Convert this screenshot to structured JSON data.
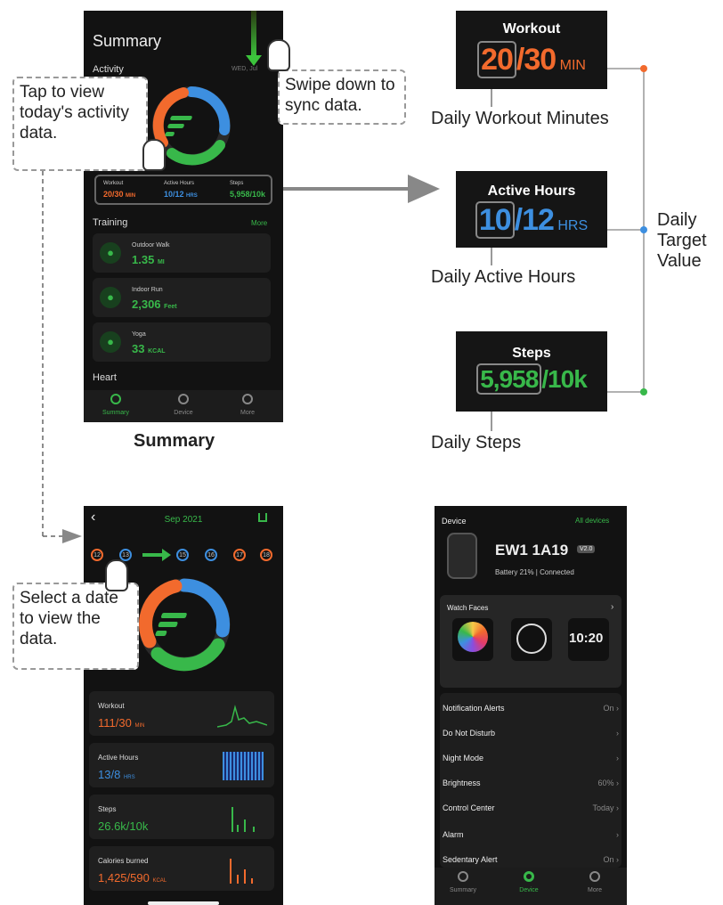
{
  "summary_screen": {
    "title": "Summary",
    "section_activity": "Activity",
    "date": "WED, Jul",
    "stats": [
      {
        "label": "Workout",
        "value": "20/30",
        "unit": "MIN"
      },
      {
        "label": "Active Hours",
        "value": "10/12",
        "unit": "HRS"
      },
      {
        "label": "Steps",
        "value": "5,958/10k",
        "unit": ""
      }
    ],
    "section_training": "Training",
    "more_link": "More",
    "trainings": [
      {
        "name": "Outdoor Walk",
        "value": "1.35",
        "unit": "MI",
        "date": ""
      },
      {
        "name": "Indoor Run",
        "value": "2,306",
        "unit": "Feet",
        "date": ""
      },
      {
        "name": "Yoga",
        "value": "33",
        "unit": "KCAL",
        "date": ""
      }
    ],
    "section_heart": "Heart",
    "tabs": [
      "Summary",
      "Device",
      "More"
    ],
    "caption": "Summary"
  },
  "callouts": {
    "workout": {
      "title": "Workout",
      "current": "20",
      "target": "/30",
      "unit": "MIN",
      "caption": "Daily Workout Minutes"
    },
    "active": {
      "title": "Active Hours",
      "current": "10",
      "target": "/12",
      "unit": "HRS",
      "caption": "Daily Active Hours"
    },
    "steps": {
      "title": "Steps",
      "current": "5,958",
      "target": "/10k",
      "caption": "Daily Steps"
    },
    "target_label": "Daily Target Value"
  },
  "annotations": {
    "tap": "Tap to view today's activity data.",
    "swipe": "Swipe down to sync data.",
    "select": "Select a date to view the data."
  },
  "detail_screen": {
    "month": "Sep 2021",
    "days": [
      "",
      "",
      "",
      "",
      "",
      "",
      ""
    ],
    "dates": [
      "12",
      "13",
      "15",
      "16",
      "17",
      "18"
    ],
    "cards": [
      {
        "label": "Workout",
        "value": "111/30",
        "unit": "MIN"
      },
      {
        "label": "Active Hours",
        "value": "13/8",
        "unit": "HRS"
      },
      {
        "label": "Steps",
        "value": "26.6k/10k",
        "unit": ""
      },
      {
        "label": "Calories burned",
        "value": "1,425/590",
        "unit": "KCAL"
      }
    ]
  },
  "device_screen": {
    "title": "Device",
    "all_devices": "All devices",
    "device_name": "EW1 1A19",
    "version": "V2.0",
    "mac": "",
    "battery": "Battery 21% | Connected",
    "watch_faces_label": "Watch Faces",
    "faces": [
      "",
      "",
      ""
    ],
    "face_time": "10:20",
    "settings": [
      {
        "label": "Notification Alerts",
        "value": "On"
      },
      {
        "label": "Do Not Disturb",
        "value": ""
      },
      {
        "label": "Night Mode",
        "value": ""
      },
      {
        "label": "Brightness",
        "value": "60%"
      },
      {
        "label": "Control Center",
        "value": "Today"
      },
      {
        "label": "Alarm",
        "value": ""
      },
      {
        "label": "Sedentary Alert",
        "value": "On"
      }
    ],
    "tabs": [
      "Summary",
      "Device",
      "More"
    ]
  },
  "colors": {
    "orange": "#f26a2d",
    "blue": "#3d8fe0",
    "green": "#38b84a",
    "bg": "#121212"
  }
}
